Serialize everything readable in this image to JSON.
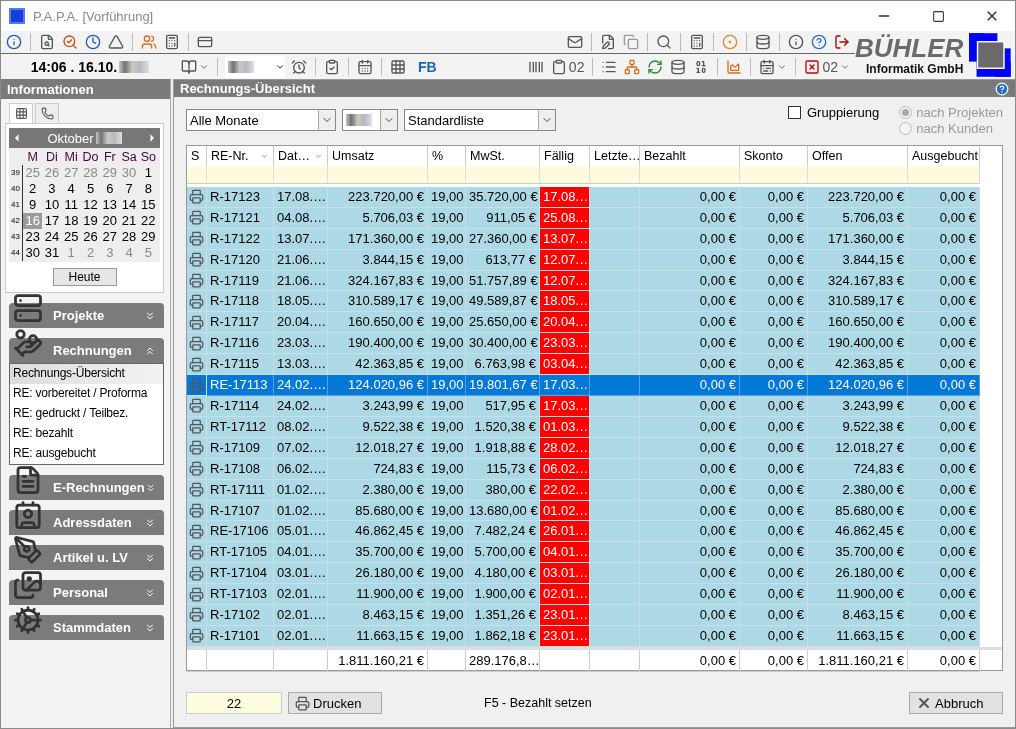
{
  "window": {
    "title": "P.A.P.A. [Vorführung]"
  },
  "toolbar": {
    "clock": "14:06 . 16.10.",
    "clipboard_count": "02",
    "fb_label": "FB",
    "delete_count": "02"
  },
  "logo": {
    "name": "BÜHLER",
    "subtitle": "Informatik GmbH"
  },
  "sidebar": {
    "title": "Informationen",
    "tabs": [
      {
        "kind": "calendar",
        "selected": true
      },
      {
        "kind": "phone",
        "selected": false
      }
    ],
    "calendar": {
      "month": "Oktober",
      "weekdays": [
        "M",
        "Di",
        "Mi",
        "Do",
        "Fr",
        "Sa",
        "So"
      ],
      "weeks": [
        {
          "number": "39",
          "days": [
            {
              "day": "25",
              "in_month": false,
              "selected": false
            },
            {
              "day": "26",
              "in_month": false,
              "selected": false
            },
            {
              "day": "27",
              "in_month": false,
              "selected": false
            },
            {
              "day": "28",
              "in_month": false,
              "selected": false
            },
            {
              "day": "29",
              "in_month": false,
              "selected": false
            },
            {
              "day": "30",
              "in_month": false,
              "selected": false
            },
            {
              "day": "1",
              "in_month": true,
              "selected": false
            }
          ]
        },
        {
          "number": "40",
          "days": [
            {
              "day": "2",
              "in_month": true,
              "selected": false
            },
            {
              "day": "3",
              "in_month": true,
              "selected": false
            },
            {
              "day": "4",
              "in_month": true,
              "selected": false
            },
            {
              "day": "5",
              "in_month": true,
              "selected": false
            },
            {
              "day": "6",
              "in_month": true,
              "selected": false
            },
            {
              "day": "7",
              "in_month": true,
              "selected": false
            },
            {
              "day": "8",
              "in_month": true,
              "selected": false
            }
          ]
        },
        {
          "number": "41",
          "days": [
            {
              "day": "9",
              "in_month": true,
              "selected": false
            },
            {
              "day": "10",
              "in_month": true,
              "selected": false
            },
            {
              "day": "11",
              "in_month": true,
              "selected": false
            },
            {
              "day": "12",
              "in_month": true,
              "selected": false
            },
            {
              "day": "13",
              "in_month": true,
              "selected": false
            },
            {
              "day": "14",
              "in_month": true,
              "selected": false
            },
            {
              "day": "15",
              "in_month": true,
              "selected": false
            }
          ]
        },
        {
          "number": "42",
          "days": [
            {
              "day": "16",
              "in_month": true,
              "selected": true
            },
            {
              "day": "17",
              "in_month": true,
              "selected": false
            },
            {
              "day": "18",
              "in_month": true,
              "selected": false
            },
            {
              "day": "19",
              "in_month": true,
              "selected": false
            },
            {
              "day": "20",
              "in_month": true,
              "selected": false
            },
            {
              "day": "21",
              "in_month": true,
              "selected": false
            },
            {
              "day": "22",
              "in_month": true,
              "selected": false
            }
          ]
        },
        {
          "number": "43",
          "days": [
            {
              "day": "23",
              "in_month": true,
              "selected": false
            },
            {
              "day": "24",
              "in_month": true,
              "selected": false
            },
            {
              "day": "25",
              "in_month": true,
              "selected": false
            },
            {
              "day": "26",
              "in_month": true,
              "selected": false
            },
            {
              "day": "27",
              "in_month": true,
              "selected": false
            },
            {
              "day": "28",
              "in_month": true,
              "selected": false
            },
            {
              "day": "29",
              "in_month": true,
              "selected": false
            }
          ]
        },
        {
          "number": "44",
          "days": [
            {
              "day": "30",
              "in_month": true,
              "selected": false
            },
            {
              "day": "31",
              "in_month": true,
              "selected": false
            },
            {
              "day": "1",
              "in_month": false,
              "selected": false
            },
            {
              "day": "2",
              "in_month": false,
              "selected": false
            },
            {
              "day": "3",
              "in_month": false,
              "selected": false
            },
            {
              "day": "4",
              "in_month": false,
              "selected": false
            },
            {
              "day": "5",
              "in_month": false,
              "selected": false
            }
          ]
        }
      ],
      "today_button": "Heute"
    },
    "sections": [
      {
        "kind": "projects",
        "label": "Projekte",
        "expanded": false
      },
      {
        "kind": "invoices",
        "label": "Rechnungen",
        "expanded": true,
        "items": [
          {
            "label": "Rechnungs-Übersicht",
            "selected": true
          },
          {
            "label": "RE: vorbereitet / Proforma",
            "selected": false
          },
          {
            "label": "RE: gedruckt / Teilbez.",
            "selected": false
          },
          {
            "label": "RE: bezahlt",
            "selected": false
          },
          {
            "label": "RE: ausgebucht",
            "selected": false
          }
        ]
      },
      {
        "kind": "e_invoices",
        "label": "E-Rechnungen",
        "expanded": false
      },
      {
        "kind": "addresses",
        "label": "Adressdaten",
        "expanded": false
      },
      {
        "kind": "articles",
        "label": "Artikel u. LV",
        "expanded": false
      },
      {
        "kind": "staff",
        "label": "Personal",
        "expanded": false
      },
      {
        "kind": "master_data",
        "label": "Stammdaten",
        "expanded": false
      }
    ]
  },
  "main": {
    "title": "Rechnungs-Übersicht",
    "filters": {
      "month": "Alle Monate",
      "list": "Standardliste"
    },
    "grouping": {
      "label": "Gruppierung",
      "checked": false
    },
    "group_by": [
      {
        "label": "nach Projekten",
        "selected": true,
        "disabled": true
      },
      {
        "label": "nach Kunden",
        "selected": false,
        "disabled": true
      }
    ],
    "table": {
      "columns": [
        {
          "label": "S"
        },
        {
          "label": "RE-Nr.",
          "sort_arrow": true
        },
        {
          "label": "Dat…",
          "sort_arrow": true
        },
        {
          "label": "Umsatz"
        },
        {
          "label": "%"
        },
        {
          "label": "MwSt."
        },
        {
          "label": "Fällig"
        },
        {
          "label": "Letzte…"
        },
        {
          "label": "Bezahlt"
        },
        {
          "label": "Skonto"
        },
        {
          "label": "Offen"
        },
        {
          "label": "Ausgebucht"
        }
      ],
      "rows": [
        {
          "selected": false,
          "overdue": true,
          "nr": "R-17123",
          "date": "17.08.…",
          "revenue": "223.720,00 €",
          "vat_rate": "19,00",
          "vat": "35.720,00 €",
          "due": "17.08.…",
          "paid": "0,00 €",
          "discount": "0,00 €",
          "open": "223.720,00 €",
          "written_off": "0,00 €"
        },
        {
          "selected": false,
          "overdue": true,
          "nr": "R-17121",
          "date": "04.08.…",
          "revenue": "5.706,03 €",
          "vat_rate": "19,00",
          "vat": "911,05 €",
          "due": "25.08.…",
          "paid": "0,00 €",
          "discount": "0,00 €",
          "open": "5.706,03 €",
          "written_off": "0,00 €"
        },
        {
          "selected": false,
          "overdue": true,
          "nr": "R-17122",
          "date": "13.07.…",
          "revenue": "171.360,00 €",
          "vat_rate": "19,00",
          "vat": "27.360,00 €",
          "due": "13.07.…",
          "paid": "0,00 €",
          "discount": "0,00 €",
          "open": "171.360,00 €",
          "written_off": "0,00 €"
        },
        {
          "selected": false,
          "overdue": true,
          "nr": "R-17120",
          "date": "21.06.…",
          "revenue": "3.844,15 €",
          "vat_rate": "19,00",
          "vat": "613,77 €",
          "due": "12.07.…",
          "paid": "0,00 €",
          "discount": "0,00 €",
          "open": "3.844,15 €",
          "written_off": "0,00 €"
        },
        {
          "selected": false,
          "overdue": true,
          "nr": "R-17119",
          "date": "21.06.…",
          "revenue": "324.167,83 €",
          "vat_rate": "19,00",
          "vat": "51.757,89 €",
          "due": "12.07.…",
          "paid": "0,00 €",
          "discount": "0,00 €",
          "open": "324.167,83 €",
          "written_off": "0,00 €"
        },
        {
          "selected": false,
          "overdue": true,
          "nr": "R-17118",
          "date": "18.05.…",
          "revenue": "310.589,17 €",
          "vat_rate": "19,00",
          "vat": "49.589,87 €",
          "due": "18.05.…",
          "paid": "0,00 €",
          "discount": "0,00 €",
          "open": "310.589,17 €",
          "written_off": "0,00 €"
        },
        {
          "selected": false,
          "overdue": true,
          "nr": "R-17117",
          "date": "20.04.…",
          "revenue": "160.650,00 €",
          "vat_rate": "19,00",
          "vat": "25.650,00 €",
          "due": "20.04.…",
          "paid": "0,00 €",
          "discount": "0,00 €",
          "open": "160.650,00 €",
          "written_off": "0,00 €"
        },
        {
          "selected": false,
          "overdue": true,
          "nr": "R-17116",
          "date": "23.03.…",
          "revenue": "190.400,00 €",
          "vat_rate": "19,00",
          "vat": "30.400,00 €",
          "due": "23.03.…",
          "paid": "0,00 €",
          "discount": "0,00 €",
          "open": "190.400,00 €",
          "written_off": "0,00 €"
        },
        {
          "selected": false,
          "overdue": true,
          "nr": "R-17115",
          "date": "13.03.…",
          "revenue": "42.363,85 €",
          "vat_rate": "19,00",
          "vat": "6.763,98 €",
          "due": "03.04.…",
          "paid": "0,00 €",
          "discount": "0,00 €",
          "open": "42.363,85 €",
          "written_off": "0,00 €"
        },
        {
          "selected": true,
          "overdue": true,
          "nr": "RE-17113",
          "date": "24.02.…",
          "revenue": "124.020,96 €",
          "vat_rate": "19,00",
          "vat": "19.801,67 €",
          "due": "17.03.…",
          "paid": "0,00 €",
          "discount": "0,00 €",
          "open": "124.020,96 €",
          "written_off": "0,00 €"
        },
        {
          "selected": false,
          "overdue": true,
          "nr": "R-17114",
          "date": "24.02.…",
          "revenue": "3.243,99 €",
          "vat_rate": "19,00",
          "vat": "517,95 €",
          "due": "17.03.…",
          "paid": "0,00 €",
          "discount": "0,00 €",
          "open": "3.243,99 €",
          "written_off": "0,00 €"
        },
        {
          "selected": false,
          "overdue": true,
          "nr": "RT-17112",
          "date": "08.02.…",
          "revenue": "9.522,38 €",
          "vat_rate": "19,00",
          "vat": "1.520,38 €",
          "due": "01.03.…",
          "paid": "0,00 €",
          "discount": "0,00 €",
          "open": "9.522,38 €",
          "written_off": "0,00 €"
        },
        {
          "selected": false,
          "overdue": true,
          "nr": "R-17109",
          "date": "07.02.…",
          "revenue": "12.018,27 €",
          "vat_rate": "19,00",
          "vat": "1.918,88 €",
          "due": "28.02.…",
          "paid": "0,00 €",
          "discount": "0,00 €",
          "open": "12.018,27 €",
          "written_off": "0,00 €"
        },
        {
          "selected": false,
          "overdue": true,
          "nr": "R-17108",
          "date": "06.02.…",
          "revenue": "724,83 €",
          "vat_rate": "19,00",
          "vat": "115,73 €",
          "due": "06.02.…",
          "paid": "0,00 €",
          "discount": "0,00 €",
          "open": "724,83 €",
          "written_off": "0,00 €"
        },
        {
          "selected": false,
          "overdue": true,
          "nr": "RT-17111",
          "date": "01.02.…",
          "revenue": "2.380,00 €",
          "vat_rate": "19,00",
          "vat": "380,00 €",
          "due": "22.02.…",
          "paid": "0,00 €",
          "discount": "0,00 €",
          "open": "2.380,00 €",
          "written_off": "0,00 €"
        },
        {
          "selected": false,
          "overdue": true,
          "nr": "R-17107",
          "date": "01.02.…",
          "revenue": "85.680,00 €",
          "vat_rate": "19,00",
          "vat": "13.680,00 €",
          "due": "01.02.…",
          "paid": "0,00 €",
          "discount": "0,00 €",
          "open": "85.680,00 €",
          "written_off": "0,00 €"
        },
        {
          "selected": false,
          "overdue": true,
          "nr": "RE-17106",
          "date": "05.01.…",
          "revenue": "46.862,45 €",
          "vat_rate": "19,00",
          "vat": "7.482,24 €",
          "due": "26.01.…",
          "paid": "0,00 €",
          "discount": "0,00 €",
          "open": "46.862,45 €",
          "written_off": "0,00 €"
        },
        {
          "selected": false,
          "overdue": true,
          "nr": "RT-17105",
          "date": "04.01.…",
          "revenue": "35.700,00 €",
          "vat_rate": "19,00",
          "vat": "5.700,00 €",
          "due": "04.01.…",
          "paid": "0,00 €",
          "discount": "0,00 €",
          "open": "35.700,00 €",
          "written_off": "0,00 €"
        },
        {
          "selected": false,
          "overdue": true,
          "nr": "RT-17104",
          "date": "03.01.…",
          "revenue": "26.180,00 €",
          "vat_rate": "19,00",
          "vat": "4.180,00 €",
          "due": "03.01.…",
          "paid": "0,00 €",
          "discount": "0,00 €",
          "open": "26.180,00 €",
          "written_off": "0,00 €"
        },
        {
          "selected": false,
          "overdue": true,
          "nr": "RT-17103",
          "date": "02.01.…",
          "revenue": "11.900,00 €",
          "vat_rate": "19,00",
          "vat": "1.900,00 €",
          "due": "02.01.…",
          "paid": "0,00 €",
          "discount": "0,00 €",
          "open": "11.900,00 €",
          "written_off": "0,00 €"
        },
        {
          "selected": false,
          "overdue": true,
          "nr": "R-17102",
          "date": "02.01.…",
          "revenue": "8.463,15 €",
          "vat_rate": "19,00",
          "vat": "1.351,26 €",
          "due": "23.01.…",
          "paid": "0,00 €",
          "discount": "0,00 €",
          "open": "8.463,15 €",
          "written_off": "0,00 €"
        },
        {
          "selected": false,
          "overdue": true,
          "nr": "R-17101",
          "date": "02.01.…",
          "revenue": "11.663,15 €",
          "vat_rate": "19,00",
          "vat": "1.862,18 €",
          "due": "23.01.…",
          "paid": "0,00 €",
          "discount": "0,00 €",
          "open": "11.663,15 €",
          "written_off": "0,00 €"
        }
      ],
      "totals": {
        "revenue": "1.811.160,21 €",
        "vat": "289.176,8…",
        "paid": "0,00 €",
        "discount": "0,00 €",
        "open": "1.811.160,21 €",
        "written_off": "0,00 €"
      }
    },
    "footer": {
      "count": "22",
      "print_button": "Drucken",
      "hint": "F5 - Bezahlt setzen",
      "cancel_button": "Abbruch"
    }
  }
}
